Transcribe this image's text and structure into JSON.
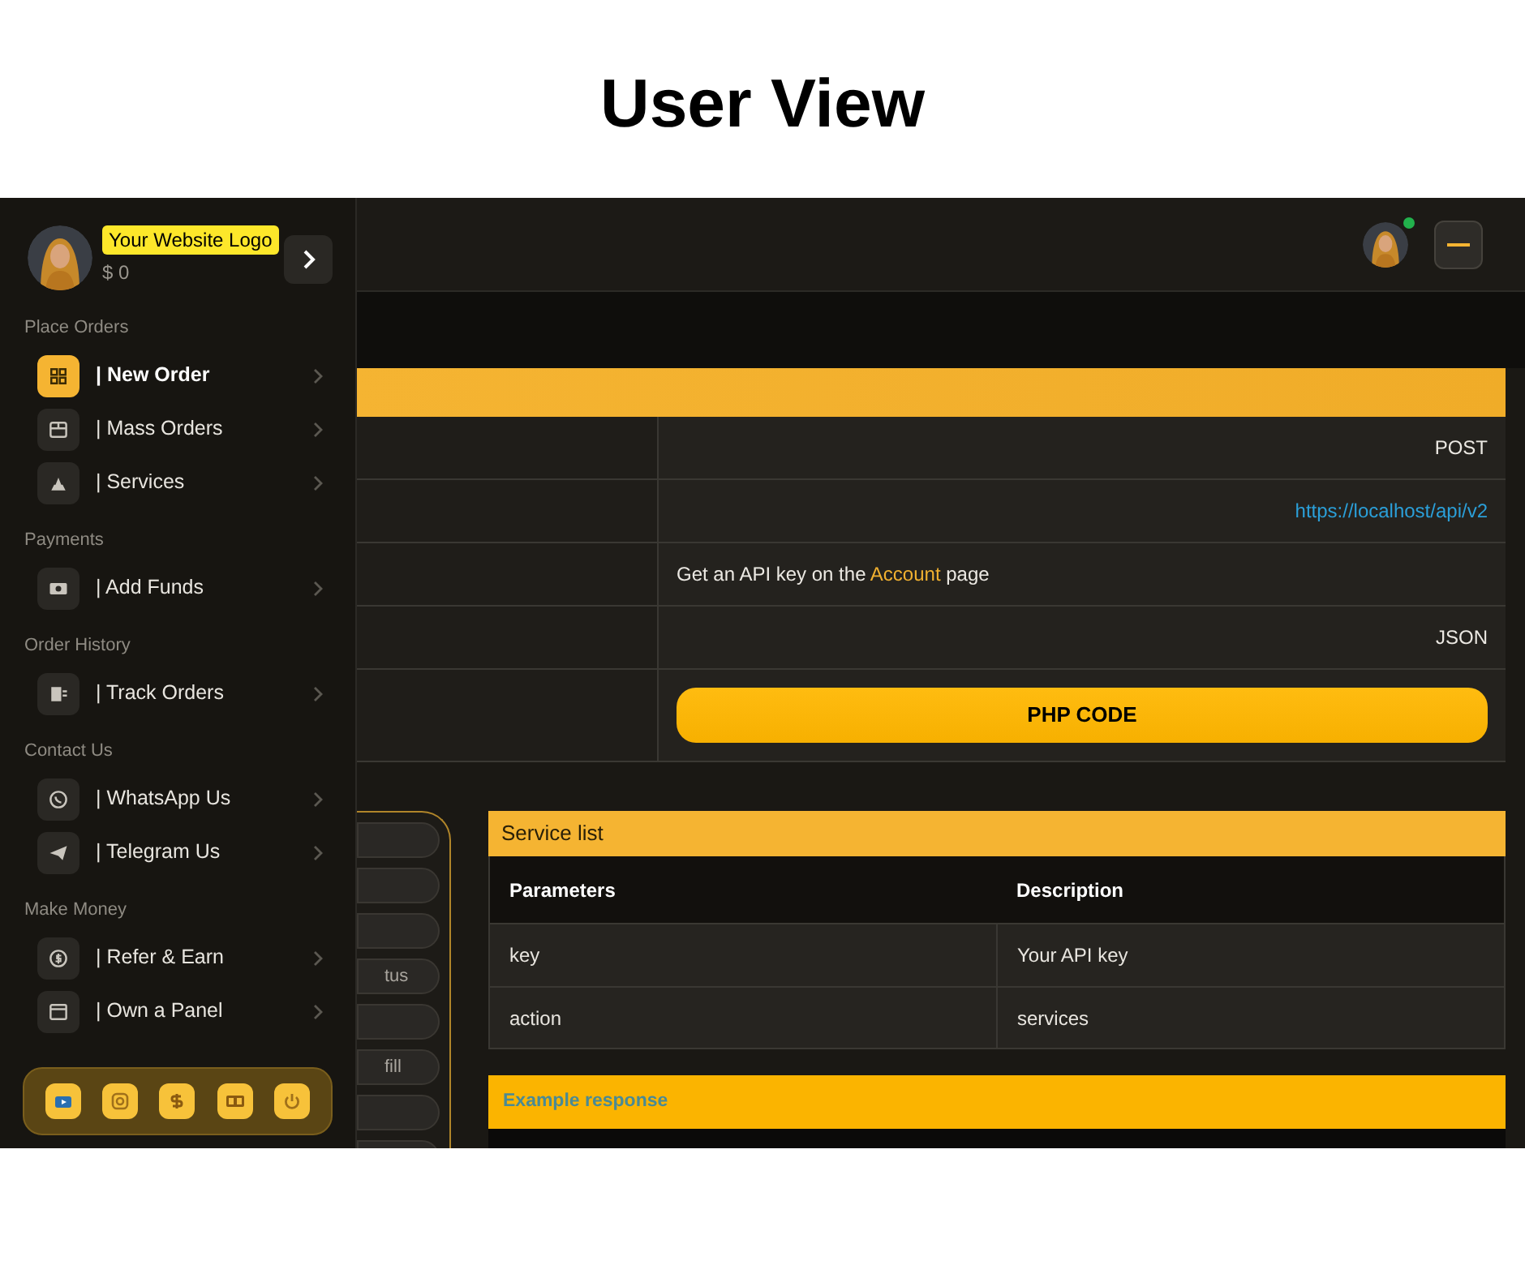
{
  "page_title": "User View",
  "sidebar": {
    "logo_label": "Your Website Logo",
    "balance": "$ 0",
    "sections": [
      {
        "heading": "Place Orders",
        "items": [
          {
            "label": "| New Order",
            "selected": true
          },
          {
            "label": "| Mass Orders",
            "selected": false
          },
          {
            "label": "| Services",
            "selected": false
          }
        ]
      },
      {
        "heading": "Payments",
        "items": [
          {
            "label": "| Add Funds",
            "selected": false
          }
        ]
      },
      {
        "heading": "Order History",
        "items": [
          {
            "label": "| Track Orders",
            "selected": false
          }
        ]
      },
      {
        "heading": "Contact Us",
        "items": [
          {
            "label": "| WhatsApp Us",
            "selected": false
          },
          {
            "label": "| Telegram Us",
            "selected": false
          }
        ]
      },
      {
        "heading": "Make Money",
        "items": [
          {
            "label": "| Refer & Earn",
            "selected": false
          },
          {
            "label": "| Own a Panel",
            "selected": false
          }
        ]
      }
    ]
  },
  "header": {
    "online": true
  },
  "api_table": {
    "rows": [
      {
        "kind": "text",
        "value": "POST"
      },
      {
        "kind": "link",
        "value": "https://localhost/api/v2"
      },
      {
        "kind": "note",
        "before": "Get an API key on the",
        "link": "Account",
        "after": "page"
      },
      {
        "kind": "text",
        "value": "JSON"
      },
      {
        "kind": "button",
        "value": "PHP CODE"
      }
    ]
  },
  "form_fields": [
    {
      "kind": "blank"
    },
    {
      "kind": "blank"
    },
    {
      "kind": "blank"
    },
    {
      "kind": "text",
      "text": "tus"
    },
    {
      "kind": "blank"
    },
    {
      "kind": "text",
      "text": "fill"
    },
    {
      "kind": "blank"
    },
    {
      "kind": "blank"
    }
  ],
  "service_list": {
    "title": "Service list",
    "columns": [
      "Parameters",
      "Description"
    ],
    "rows": [
      [
        "key",
        "Your API key"
      ],
      [
        "action",
        "services"
      ]
    ]
  },
  "example_response": {
    "title": "Example response"
  }
}
